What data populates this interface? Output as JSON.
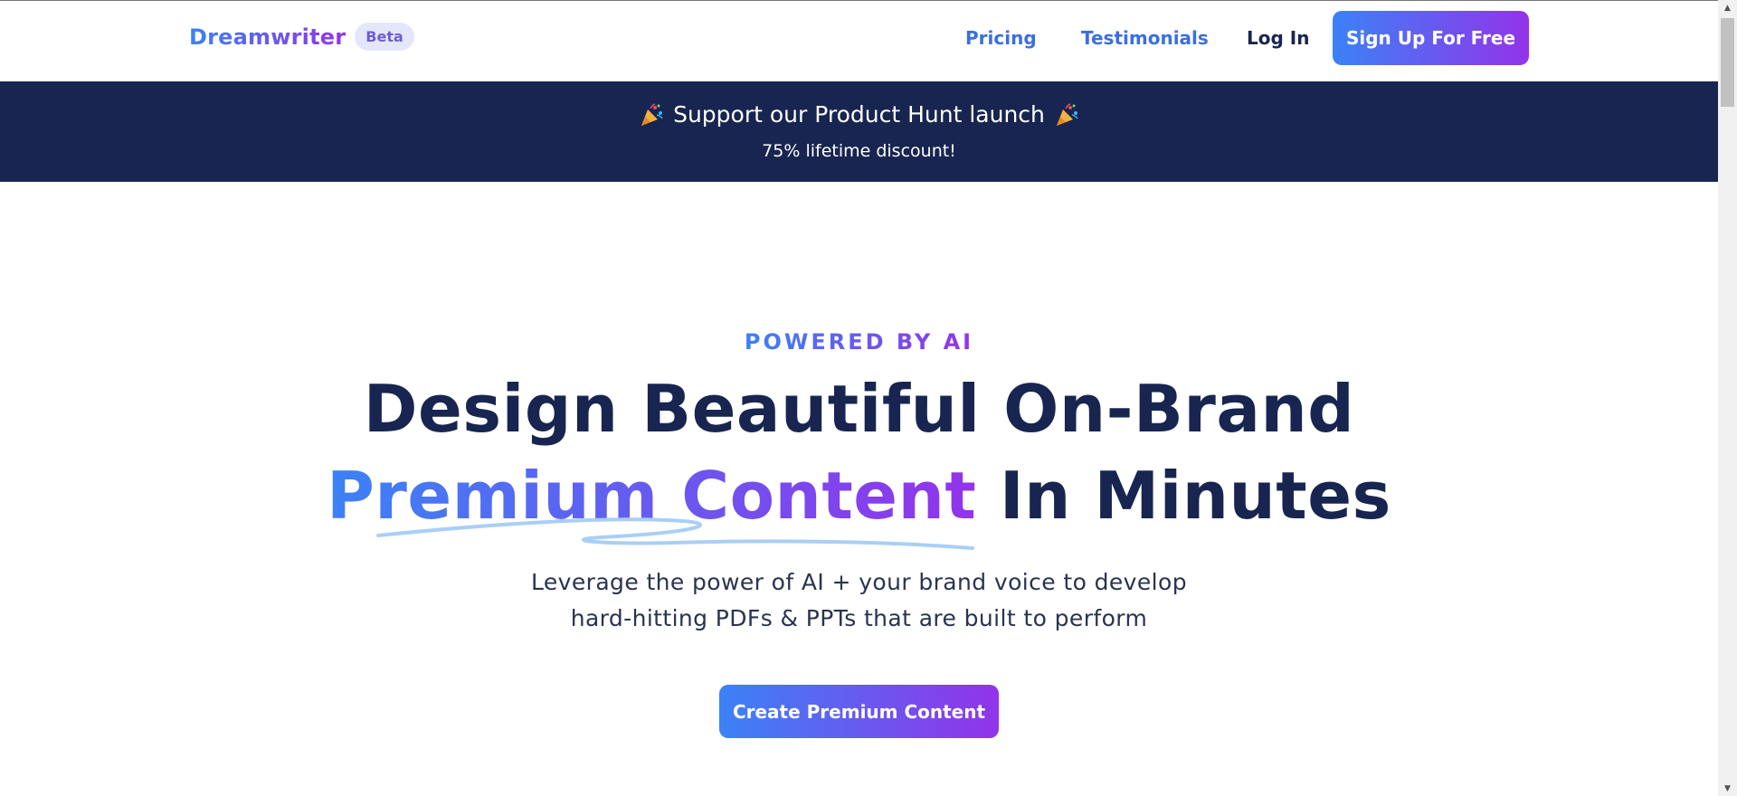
{
  "navbar": {
    "brand": "Dreamwriter",
    "badge": "Beta",
    "links": {
      "pricing": "Pricing",
      "testimonials": "Testimonials",
      "login": "Log In"
    },
    "signup_label": "Sign Up For Free"
  },
  "banner": {
    "title": "Support our Product Hunt launch",
    "subtitle": "75% lifetime discount!",
    "icon": "party-popper-icon"
  },
  "hero": {
    "eyebrow": "POWERED BY AI",
    "headline_line1": "Design Beautiful On-Brand",
    "headline_gradient": "Premium Content",
    "headline_rest": "In Minutes",
    "subtext_line1": "Leverage the power of AI + your brand voice to develop",
    "subtext_line2": "hard-hitting PDFs & PPTs that are built to perform",
    "cta_label": "Create Premium Content"
  },
  "colors": {
    "navy": "#172550",
    "gradient_start": "#3b82f6",
    "gradient_end": "#9333ea",
    "underline": "#a9cff5"
  }
}
